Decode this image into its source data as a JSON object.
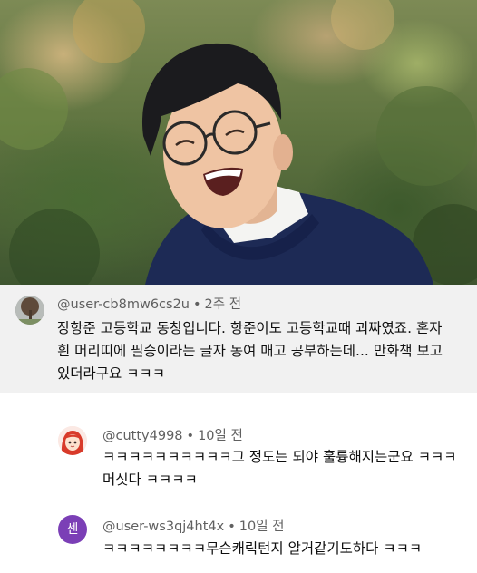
{
  "main_comment": {
    "handle": "@user-cb8mw6cs2u",
    "separator": "•",
    "time": "2주 전",
    "lines": [
      "장항준 고등학교 동창입니다. 항준이도 고등학교때 괴짜였죠. 혼자",
      "흰 머리띠에 필승이라는 글자 동여 매고 공부하는데... 만화책 보고",
      "있더라구요 ㅋㅋㅋ"
    ]
  },
  "replies": [
    {
      "handle": "@cutty4998",
      "separator": "•",
      "time": "10일 전",
      "lines": [
        "ㅋㅋㅋㅋㅋㅋㅋㅋㅋㅋ그 정도는 되야 훌륭해지는군요 ㅋㅋㅋ",
        "머싯다 ㅋㅋㅋㅋ"
      ]
    },
    {
      "handle": "@user-ws3qj4ht4x",
      "separator": "•",
      "time": "10일 전",
      "avatar_initial": "센",
      "lines": [
        "ㅋㅋㅋㅋㅋㅋㅋㅋ무슨캐릭턴지 알거같기도하다 ㅋㅋㅋ"
      ]
    }
  ],
  "colors": {
    "main_comment_bg": "#f1f1f1",
    "meta_text": "#606060",
    "body_text": "#0f0f0f",
    "reply2_avatar": "#7b3fb6"
  }
}
